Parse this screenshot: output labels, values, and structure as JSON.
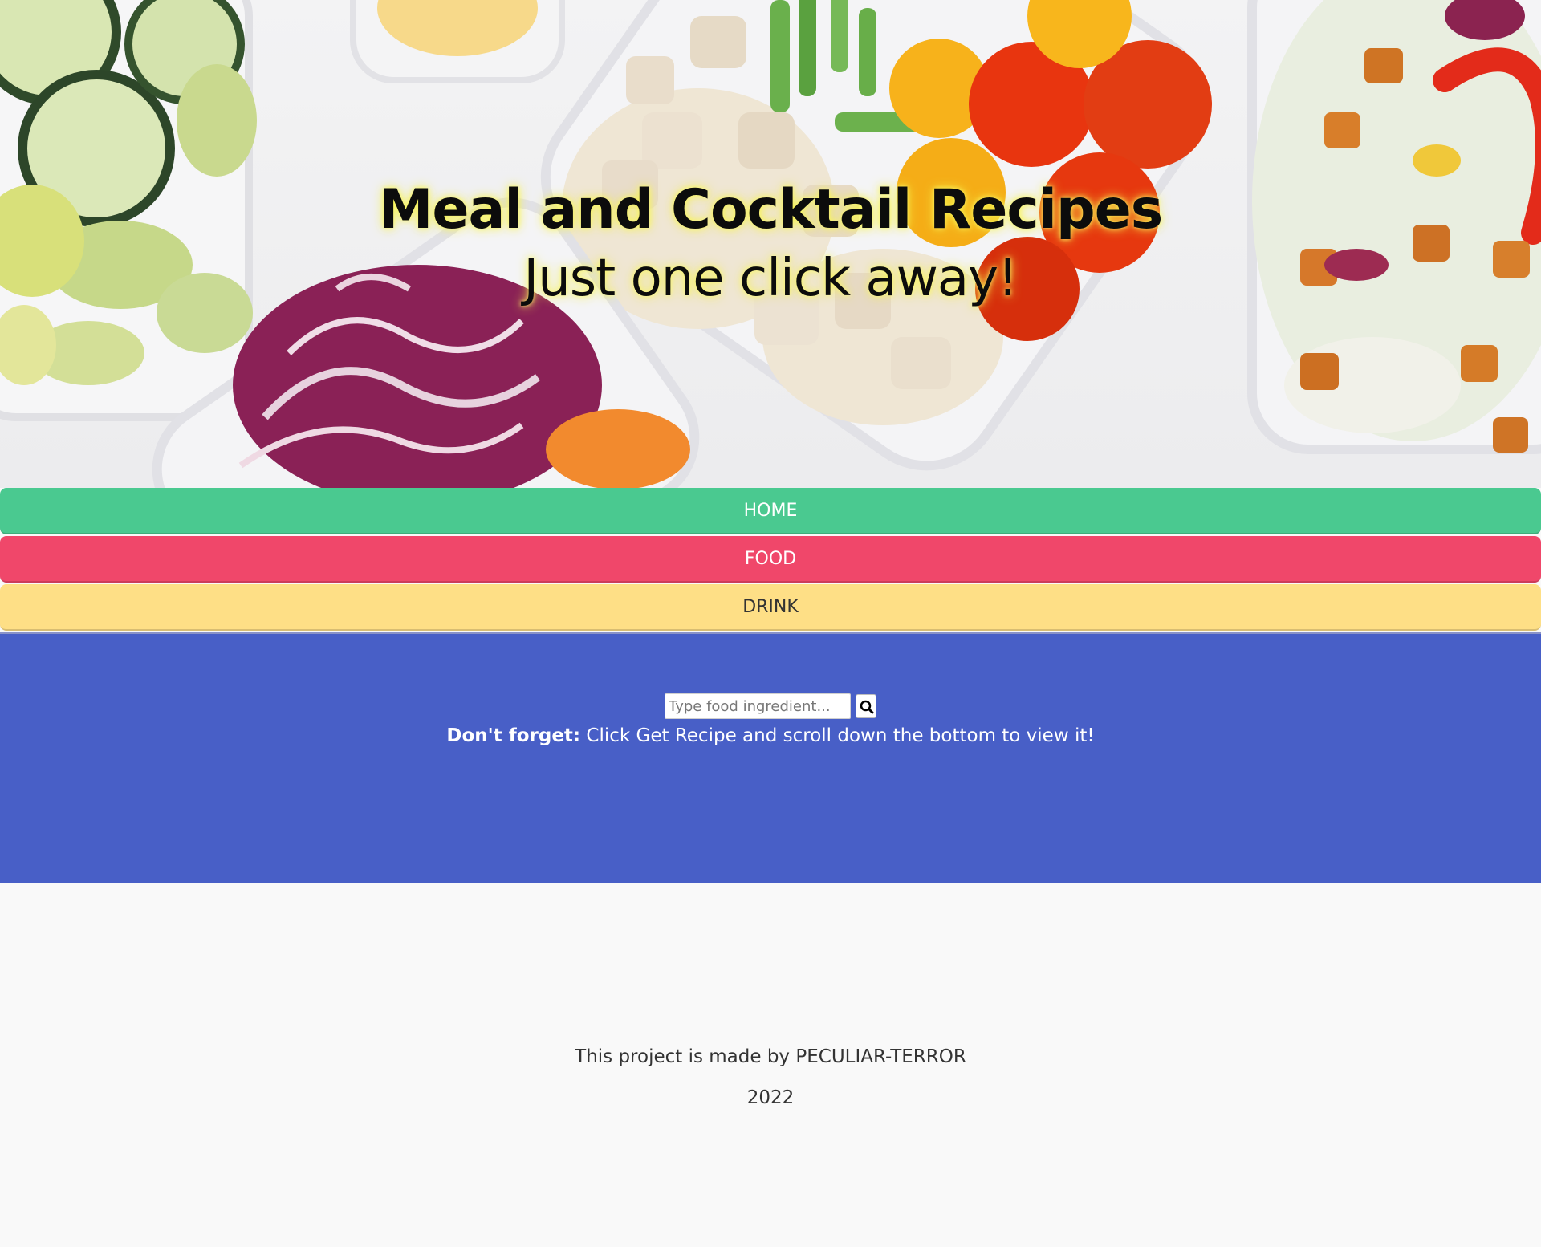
{
  "hero": {
    "title": "Meal and Cocktail Recipes",
    "subtitle": "Just one click away!"
  },
  "nav": {
    "home": "HOME",
    "food": "FOOD",
    "drink": "DRINK"
  },
  "colors": {
    "home": "#4ac990",
    "food": "#f0476a",
    "drink": "#fedf86",
    "search_section": "#485fc7",
    "footer_bg": "#f9f9f9"
  },
  "search": {
    "placeholder": "Type food ingredient...",
    "value": "",
    "button_icon": "search-icon"
  },
  "reminder": {
    "bold": "Don't forget:",
    "text": " Click Get Recipe and scroll down the bottom to view it!"
  },
  "footer": {
    "credit": "This project is made by PECULIAR-TERROR",
    "year": "2022"
  }
}
